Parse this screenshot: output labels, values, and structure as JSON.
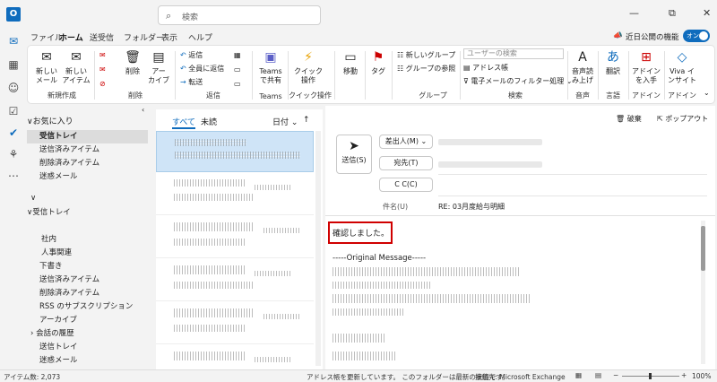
{
  "window": {
    "search_placeholder": "検索",
    "minimize": "—",
    "restore": "⧉",
    "close": "✕"
  },
  "tabs": [
    "ファイル",
    "ホーム",
    "送受信",
    "フォルダー",
    "表示",
    "ヘルプ"
  ],
  "new_features": {
    "label": "近日公開の機能",
    "toggle": "オン"
  },
  "ribbon": {
    "new_mail": "新しい\nメール",
    "new_item": "新しい\nアイテム",
    "group_new": "新規作成",
    "delete": "削除",
    "archive": "アー\nカイブ",
    "group_delete": "削除",
    "reply": "返信",
    "reply_all": "全員に返信",
    "forward": "転送",
    "group_respond": "返信",
    "teams_share": "Teams\nで共有",
    "group_teams": "Teams",
    "quick_steps": "クイック\n操作",
    "group_quick": "クイック操作",
    "move": "移動",
    "tags": "タグ",
    "new_group": "新しいグループ",
    "browse_groups": "グループの参照",
    "group_groups": "グループ",
    "search_people": "ユーザーの検索",
    "address_book": "アドレス帳",
    "filter_email": "電子メールのフィルター処理",
    "group_find": "検索",
    "read_aloud": "音声読\nみ上げ",
    "group_speech": "音声",
    "translate": "翻訳",
    "group_language": "言語",
    "get_addins": "アドイン\nを入手",
    "group_addins": "アドイン",
    "viva": "Viva イ\nンサイト",
    "group_viva": "アドイン"
  },
  "folders": {
    "favorites": "お気に入り",
    "items": [
      "受信トレイ",
      "送信済みアイテム",
      "削除済みアイテム",
      "迷惑メール"
    ],
    "account_inbox": "受信トレイ",
    "sub": [
      "社内",
      "人事関連"
    ],
    "rest": [
      "下書き",
      "送信済みアイテム",
      "削除済みアイテム",
      "RSS のサブスクリプション",
      "アーカイブ",
      "会話の履歴",
      "送信トレイ",
      "迷惑メール"
    ]
  },
  "list": {
    "tab_all": "すべて",
    "tab_unread": "未読",
    "sort": "日付",
    "sort_dir": "↑"
  },
  "reading": {
    "discard": "破棄",
    "popout": "ポップアウト",
    "send": "送信(S)",
    "from": "差出人(M)",
    "to": "宛先(T)",
    "cc": "C C(C)",
    "subject_label": "件名(U)",
    "subject_value": "RE: 03月度給与明細",
    "body_first": "確認しました。",
    "original": "-----Original Message-----"
  },
  "status": {
    "count": "アイテム数: 2,073",
    "message": "アドレス帳を更新しています。  このフォルダーは最新の状態です。",
    "connection": "接続先: Microsoft Exchange",
    "zoom": "100%"
  },
  "colors": {
    "accent": "#0f6cbd",
    "highlight": "#d00000"
  }
}
